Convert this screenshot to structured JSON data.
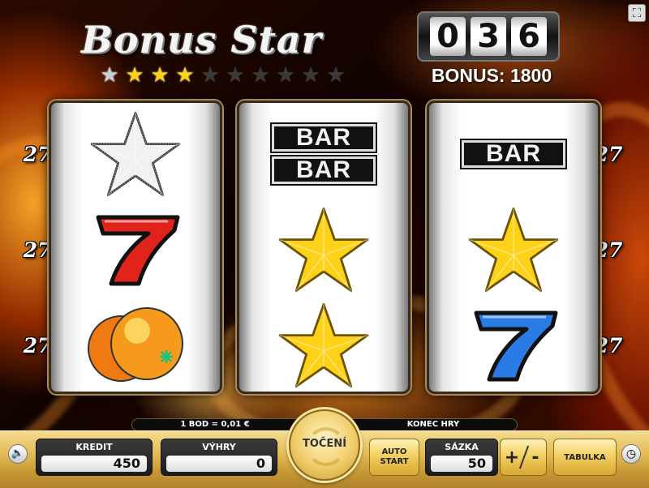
{
  "game": {
    "title": "Bonus Star",
    "counter": [
      "0",
      "3",
      "6"
    ],
    "bonus_text": "BONUS: 1800",
    "stars_lit_silver": 1,
    "stars_lit_gold": 3,
    "stars_total": 10
  },
  "reels": [
    {
      "symbols": [
        "star-silver",
        "seven-red",
        "orange"
      ]
    },
    {
      "symbols": [
        "double-bar",
        "star-gold",
        "star-gold"
      ]
    },
    {
      "symbols": [
        "bar",
        "star-gold",
        "seven-blue"
      ]
    }
  ],
  "bar_text": "BAR",
  "line_labels": {
    "left": [
      "27",
      "27",
      "27"
    ],
    "right": [
      "27",
      "27",
      "27"
    ]
  },
  "info": {
    "rate": "1 BOD = 0,01 €",
    "status": "KONEC HRY"
  },
  "controls": {
    "credit_label": "KREDIT",
    "credit_value": "450",
    "wins_label": "VÝHRY",
    "wins_value": "0",
    "spin_label": "TOČENÍ",
    "autostart_line1": "AUTO",
    "autostart_line2": "START",
    "bet_label": "SÁZKA",
    "bet_value": "50",
    "plus_label": "+",
    "minus_label": "-",
    "table_label": "TABULKA"
  },
  "colors": {
    "gold": "#ffd21a",
    "panel": "#e3bb55",
    "red_seven": "#e0241c",
    "blue_seven": "#2b7be6"
  },
  "icons": {
    "sound": "speaker-icon",
    "clock": "clock-icon",
    "fullscreen": "fullscreen-icon"
  }
}
